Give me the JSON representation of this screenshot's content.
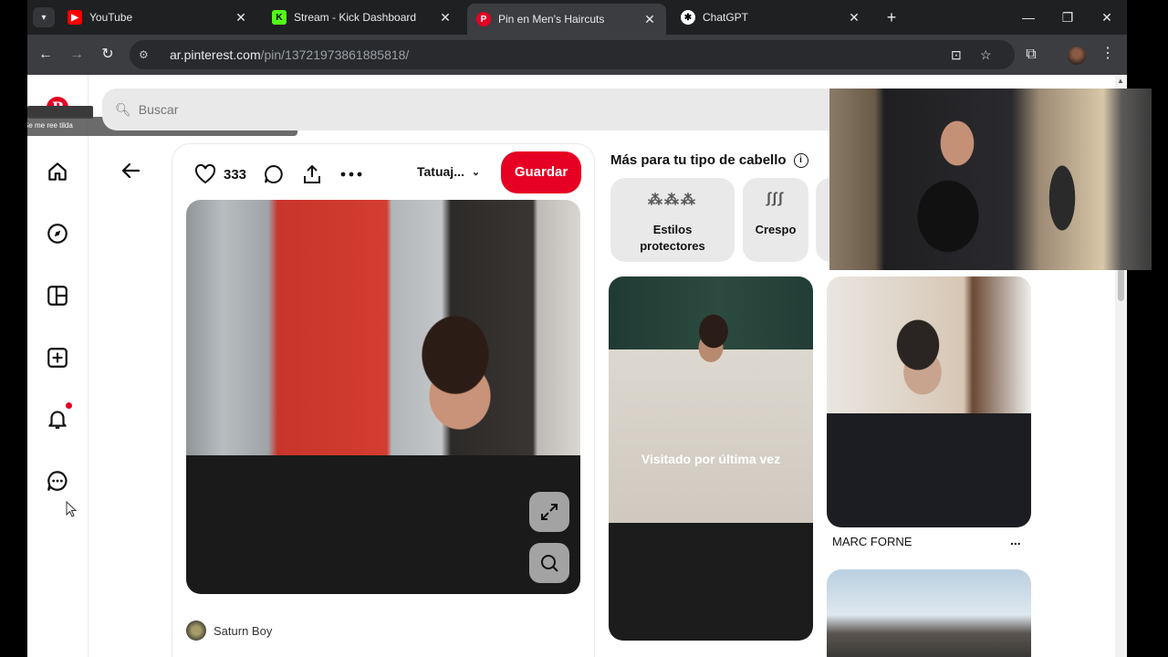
{
  "browser": {
    "tabs": [
      {
        "title": "YouTube",
        "favicon": "youtube-favicon",
        "color": "#ff0000",
        "active": false
      },
      {
        "title": "Stream - Kick Dashboard",
        "favicon": "kick-favicon",
        "color": "#53fc18",
        "active": false
      },
      {
        "title": "Pin en Men's Haircuts",
        "favicon": "pinterest-favicon",
        "color": "#e60023",
        "active": true
      },
      {
        "title": "ChatGPT",
        "favicon": "chatgpt-favicon",
        "color": "#ffffff",
        "active": false
      }
    ],
    "url_host": "ar.pinterest.com",
    "url_path": "/pin/13721973861885818/"
  },
  "pinterest": {
    "search_placeholder": "Buscar",
    "tooltip_text": "Se me ree tilda",
    "sidebar_icons": [
      "home-icon",
      "explore-icon",
      "boards-icon",
      "create-icon",
      "notifications-icon",
      "messages-icon"
    ],
    "pin": {
      "likes": "333",
      "board_select": "Tatuaj...",
      "save_label": "Guardar",
      "creator_name": "Saturn Boy"
    },
    "more_title": "Más para tu tipo de cabello",
    "hair_chips": [
      {
        "label_line1": "Estilos",
        "label_line2": "protectores"
      },
      {
        "label_line1": "Crespo",
        "label_line2": ""
      }
    ],
    "related": {
      "visited_overlay": "Visitado por última vez",
      "tile2_caption": "MARC FORNE",
      "more_dots": "..."
    }
  }
}
